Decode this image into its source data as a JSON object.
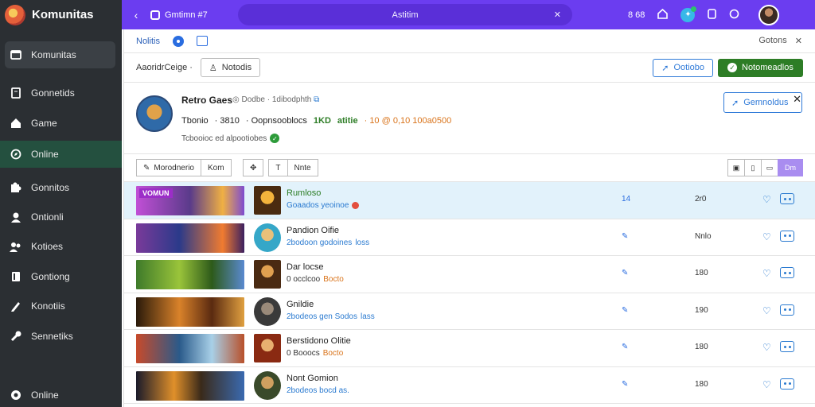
{
  "app": {
    "name": "Komunitas"
  },
  "sidebar": {
    "items": [
      {
        "label": "Komunitas",
        "icon": "window-icon"
      },
      {
        "label": "Gonnetids",
        "icon": "document-icon"
      },
      {
        "label": "Game",
        "icon": "home-icon"
      },
      {
        "label": "Online",
        "icon": "compass-icon"
      },
      {
        "label": "Gonnitos",
        "icon": "puzzle-icon"
      },
      {
        "label": "Ontionli",
        "icon": "user-icon"
      },
      {
        "label": "Kotioes",
        "icon": "users-icon"
      },
      {
        "label": "Gontiong",
        "icon": "book-icon"
      },
      {
        "label": "Konotiis",
        "icon": "pencil-icon"
      },
      {
        "label": "Sennetiks",
        "icon": "wrench-icon"
      },
      {
        "label": "Online",
        "icon": "power-icon"
      }
    ]
  },
  "topbar": {
    "context": "Gmtimn #7",
    "search_text": "Astitim",
    "counter": "8 68"
  },
  "tabs": {
    "label": "Nolitis",
    "right_label": "Gotons"
  },
  "toolbar": {
    "label": "AaoridrCeige ·",
    "filter_button": "Notodis",
    "blue_button": "Ootiobo",
    "green_button": "Notomeadlos"
  },
  "profile": {
    "name": "Retro Gaes",
    "sub": "Dodbe · 1dibodphth",
    "stat1": "Tbonio",
    "stat2": "· 3810",
    "stat3": "· Oopnsooblocs",
    "stat4": "1KD",
    "stat5": "atitie",
    "stat6": "· 10 @ 0,10 100a0500",
    "description": "Tcbooioc ed alpootiobes",
    "button": "Gemnoldus"
  },
  "filters": {
    "left": [
      "Morodnerio",
      "Kom"
    ],
    "middle": [
      "Nnte"
    ],
    "right": [
      "Dm"
    ]
  },
  "rows": [
    {
      "banner_text": "VOMUN",
      "title": "Rumloso",
      "subtitle": "Goaados yeoinoe",
      "subtitle_highlight": "",
      "col1": "14",
      "col2": "2r0",
      "selected": true
    },
    {
      "banner_text": "",
      "title": "Pandion Oifie",
      "subtitle": "2bodoon godoines",
      "subtitle_highlight": "loss",
      "col1": "✎",
      "col2": "Nnlo",
      "selected": false
    },
    {
      "banner_text": "",
      "title": "Dar locse",
      "subtitle": "0 occlcoo",
      "subtitle_highlight": "Bocto",
      "col1": "✎",
      "col2": "180",
      "selected": false
    },
    {
      "banner_text": "",
      "title": "Gnildie",
      "subtitle": "2bodeos gen Sodos",
      "subtitle_highlight": "lass",
      "col1": "✎",
      "col2": "190",
      "selected": false
    },
    {
      "banner_text": "",
      "title": "Berstidono Olitie",
      "subtitle": "0 Booocs",
      "subtitle_highlight": "Bocto",
      "col1": "✎",
      "col2": "180",
      "selected": false
    },
    {
      "banner_text": "",
      "title": "Nont Gomion",
      "subtitle": "2bodeos bocd as.",
      "subtitle_highlight": "",
      "col1": "✎",
      "col2": "180",
      "selected": false
    }
  ]
}
